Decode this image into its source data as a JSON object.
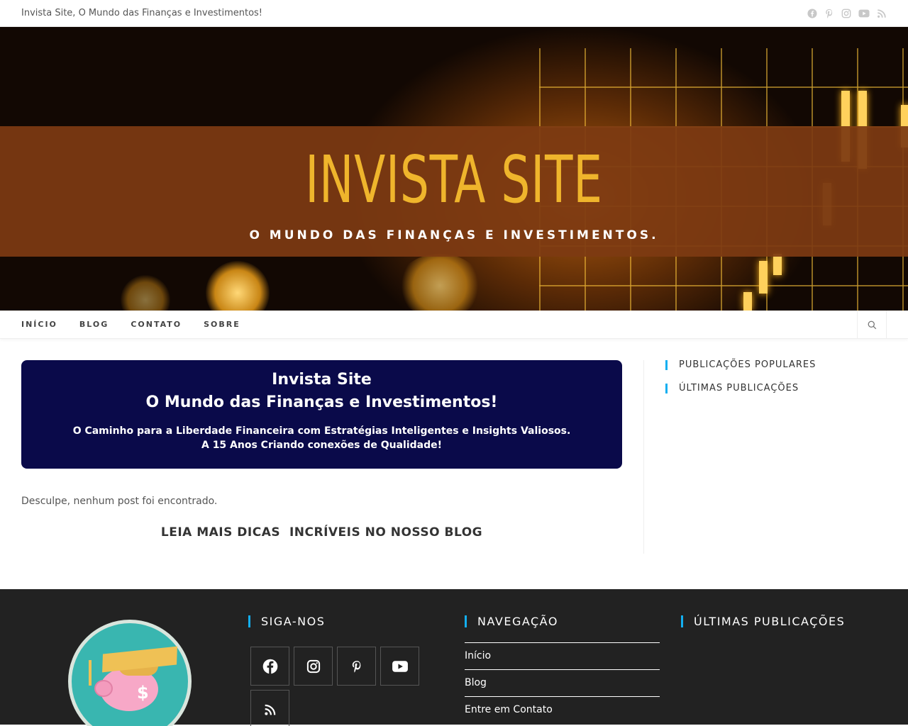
{
  "topbar": {
    "tagline": "Invista Site, O Mundo das Finanças e Investimentos!",
    "social_icons": [
      "facebook-icon",
      "pinterest-icon",
      "instagram-icon",
      "youtube-icon",
      "rss-icon"
    ]
  },
  "hero": {
    "title": "INVISTA SITE",
    "subtitle": "O MUNDO DAS FINANÇAS E INVESTIMENTOS."
  },
  "nav": {
    "items": [
      {
        "label": "INÍCIO"
      },
      {
        "label": "BLOG"
      },
      {
        "label": "CONTATO"
      },
      {
        "label": "SOBRE"
      }
    ],
    "search_icon": "search-icon"
  },
  "promo": {
    "line1": "Invista Site",
    "line2": "O Mundo das Finanças e Investimentos!",
    "text1": "O Caminho para a Liberdade Financeira com Estratégias Inteligentes e Insights Valiosos.",
    "text2": "A 15 Anos Criando conexões de Qualidade!"
  },
  "main": {
    "not_found": "Desculpe, nenhum post foi encontrado.",
    "read_more": "LEIA MAIS DICAS  INCRÍVEIS NO NOSSO BLOG"
  },
  "sidebar": {
    "widgets": [
      {
        "title": "PUBLICAÇÕES POPULARES"
      },
      {
        "title": "ÚLTIMAS PUBLICAÇÕES"
      }
    ]
  },
  "footer": {
    "follow_title": "SIGA-NOS",
    "nav_title": "NAVEGAÇÃO",
    "latest_title": "ÚLTIMAS PUBLICAÇÕES",
    "nav_links": [
      {
        "label": "Início"
      },
      {
        "label": "Blog"
      },
      {
        "label": "Entre em Contato"
      }
    ],
    "social_icons": [
      "facebook-icon",
      "instagram-icon",
      "pinterest-icon",
      "youtube-icon",
      "rss-icon"
    ]
  },
  "colors": {
    "accent": "#13aff0",
    "promo_bg": "#0a0a4a",
    "hero_title": "#efb52c",
    "footer_bg": "#222222"
  }
}
